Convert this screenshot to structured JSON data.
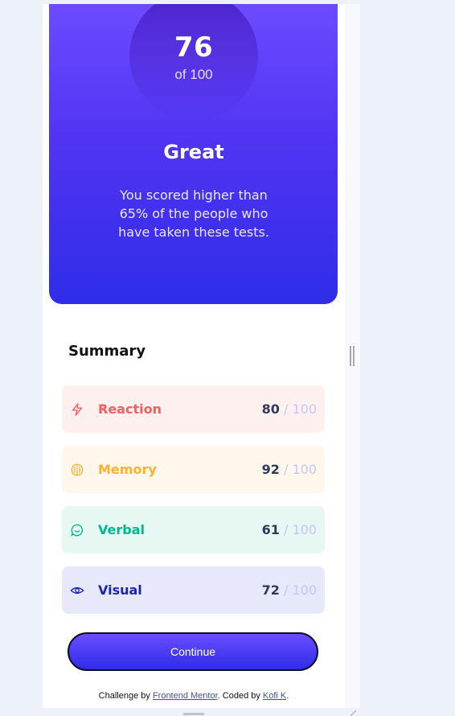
{
  "result": {
    "score": "76",
    "score_of": "of 100",
    "rating": "Great",
    "description": "You scored higher than 65% of the people who have taken these tests."
  },
  "summary": {
    "title": "Summary",
    "items": [
      {
        "label": "Reaction",
        "icon": "lightning-icon",
        "score": "80",
        "separator": "/",
        "max": "100",
        "accent": "#f55e5e",
        "bg": "#fff0f0"
      },
      {
        "label": "Memory",
        "icon": "brain-icon",
        "score": "92",
        "separator": "/",
        "max": "100",
        "accent": "#fbb22d",
        "bg": "#fff7eb"
      },
      {
        "label": "Verbal",
        "icon": "speech-bubble-icon",
        "score": "61",
        "separator": "/",
        "max": "100",
        "accent": "#00b98d",
        "bg": "#e7f7f1"
      },
      {
        "label": "Visual",
        "icon": "eye-icon",
        "score": "72",
        "separator": "/",
        "max": "100",
        "accent": "#1c25b0",
        "bg": "#e8e8fb"
      }
    ]
  },
  "continue_label": "Continue",
  "attribution": {
    "prefix": "Challenge by ",
    "link1": "Frontend Mentor",
    "middle": ". Coded by ",
    "link2": "Kofi K",
    "suffix": "."
  },
  "colors": {
    "gradient_top": "#6c4bff",
    "gradient_bottom": "#2f2de8",
    "page_bg": "#edf1fa"
  }
}
